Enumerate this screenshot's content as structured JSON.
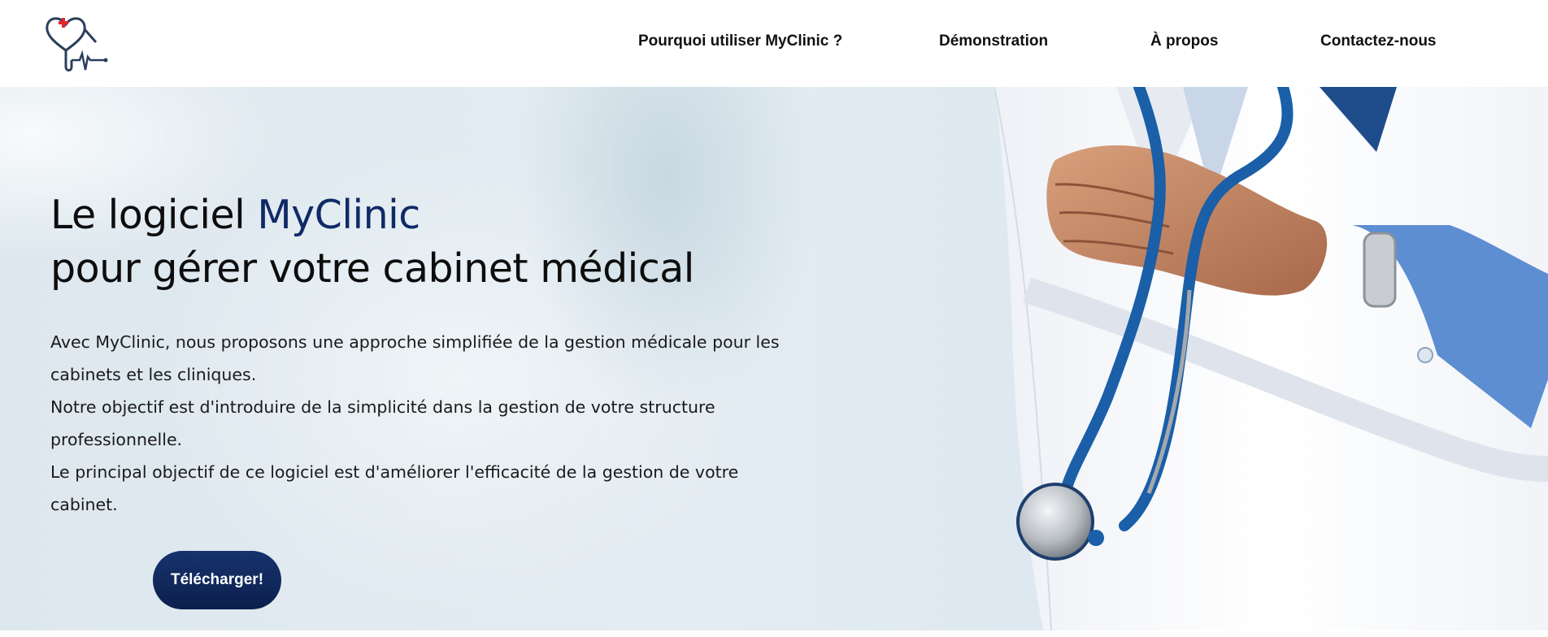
{
  "header": {
    "logo_icon": "stethoscope-heart-logo-icon",
    "nav": [
      {
        "label": "Pourquoi utiliser MyClinic ?"
      },
      {
        "label": "Démonstration"
      },
      {
        "label": "À propos"
      },
      {
        "label": "Contactez-nous"
      }
    ]
  },
  "hero": {
    "title_prefix": "Le logiciel ",
    "title_brand": "MyClinic",
    "title_line2": "pour gérer votre cabinet médical",
    "paragraphs": [
      "Avec MyClinic, nous proposons une approche simplifiée de la gestion médicale pour les cabinets et les cliniques.",
      "Notre objectif est d'introduire de la simplicité dans la gestion de votre structure professionnelle.",
      "Le principal objectif de ce logiciel est d'améliorer l'efficacité de la gestion de votre cabinet."
    ],
    "cta_label": "Télécharger!",
    "image_icon": "doctor-with-stethoscope-image"
  },
  "colors": {
    "brand": "#102a66",
    "button": "#0b1f4c",
    "logo_cross": "#e3262b",
    "logo_line": "#2b3f5c"
  }
}
